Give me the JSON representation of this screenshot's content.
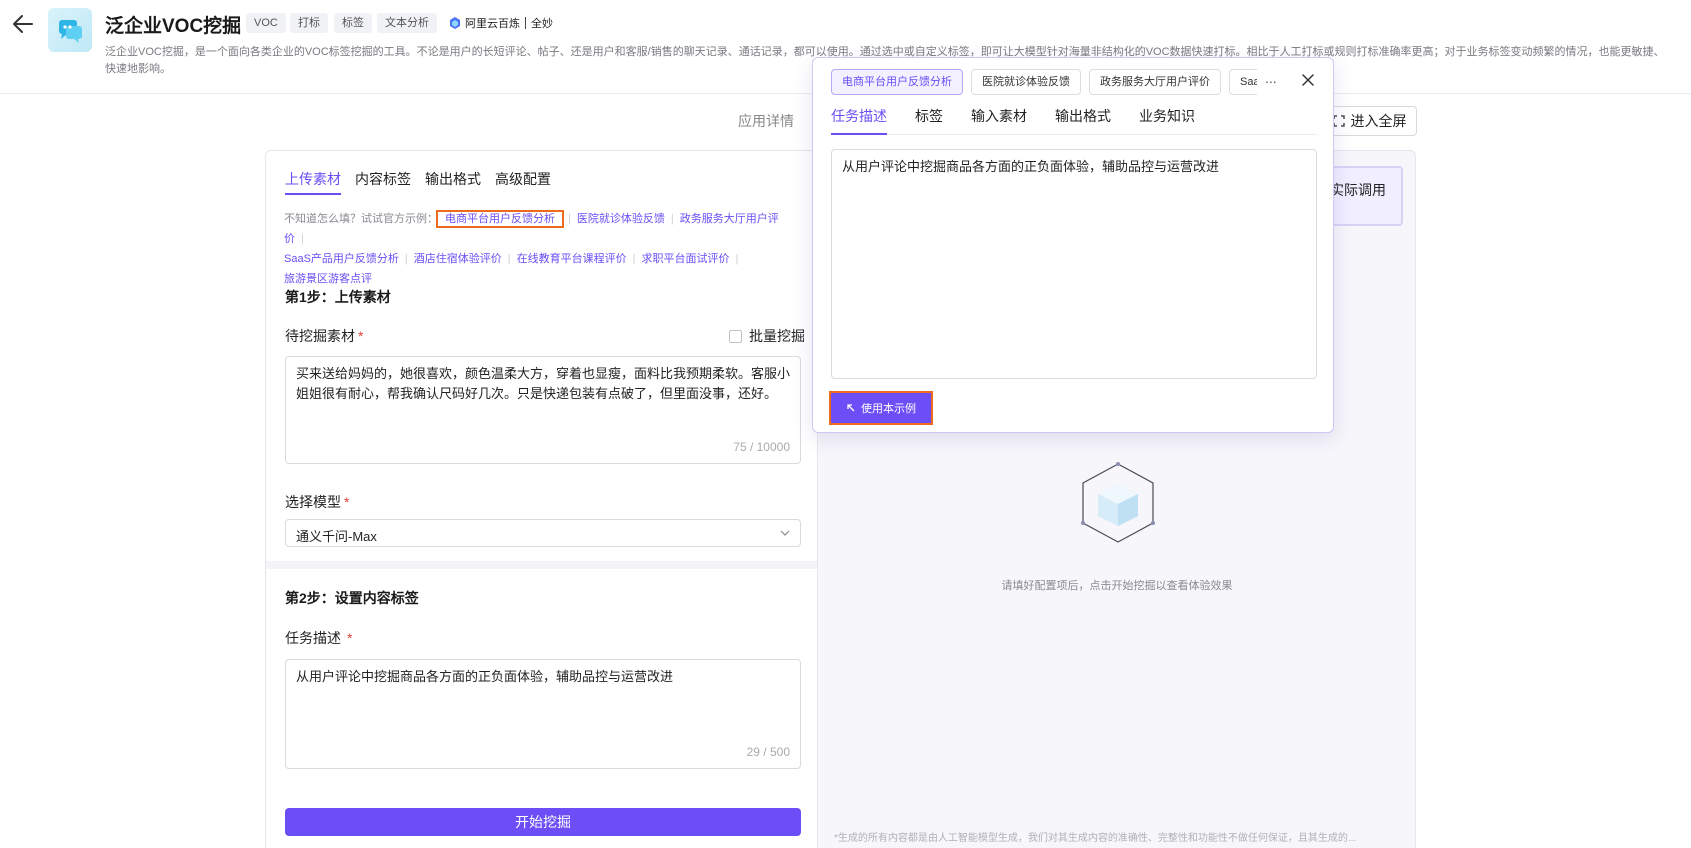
{
  "header": {
    "title": "泛企业VOC挖掘",
    "tags": [
      "VOC",
      "打标",
      "标签",
      "文本分析"
    ],
    "brand_left": "阿里云百炼",
    "brand_right": "全妙",
    "description": "泛企业VOC挖掘，是一个面向各类企业的VOC标签挖掘的工具。不论是用户的长短评论、帖子、还是用户和客服/销售的聊天记录、通话记录，都可以使用。通过选中或自定义标签，即可让大模型针对海量非结构化的VOC数据快速打标。相比于人工打标或规则打标准确率更高；对于业务标签变动频繁的情况，也能更敏捷、快速地影响。"
  },
  "toolbar": {
    "app_detail": "应用详情",
    "fullscreen_label": "进入全屏"
  },
  "left": {
    "tabs": [
      "上传素材",
      "内容标签",
      "输出格式",
      "高级配置"
    ],
    "examples_prefix": "不知道怎么填？试试官方示例：",
    "examples": [
      "电商平台用户反馈分析",
      "医院就诊体验反馈",
      "政务服务大厅用户评价",
      "SaaS产品用户反馈分析",
      "酒店住宿体验评价",
      "在线教育平台课程评价",
      "求职平台面试评价",
      "旅游景区游客点评"
    ],
    "step1_title": "第1步：上传素材",
    "material_label": "待挖掘素材",
    "batch_label": "批量挖掘",
    "material_text": "买来送给妈妈的，她很喜欢，颜色温柔大方，穿着也显瘦，面料比我预期柔软。客服小姐姐很有耐心，帮我确认尺码好几次。只是快递包装有点破了，但里面没事，还好。",
    "material_count": "75 / 10000",
    "model_label": "选择模型",
    "model_value": "通义千问-Max",
    "step2_title": "第2步：设置内容标签",
    "task_label": "任务描述",
    "task_text": "从用户评论中挖掘商品各方面的正负面体验，辅助品控与运营改进",
    "task_count": "29 / 500",
    "start_label": "开始挖掘"
  },
  "right": {
    "call_label": "实际调用",
    "empty_tip": "请填好配置项后，点击开始挖掘以查看体验效果",
    "disclaimer": "*生成的所有内容都是由人工智能模型生成，我们对其生成内容的准确性、完整性和功能性不做任何保证，且其生成的..."
  },
  "popover": {
    "pills": [
      "电商平台用户反馈分析",
      "医院就诊体验反馈",
      "政务服务大厅用户评价",
      "SaaS产品用户反馈分析"
    ],
    "more": "...",
    "tabs": [
      "任务描述",
      "标签",
      "输入素材",
      "输出格式",
      "业务知识"
    ],
    "text": "从用户评论中挖掘商品各方面的正负面体验，辅助品控与运营改进",
    "use_label": "使用本示例"
  },
  "colors": {
    "accent": "#6b4ef6",
    "highlight": "#ee6b1d"
  }
}
